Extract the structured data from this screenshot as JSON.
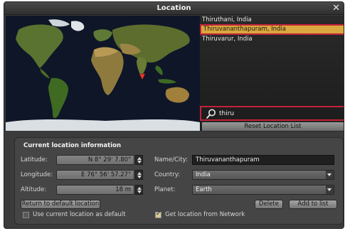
{
  "window": {
    "title": "Location",
    "close_glyph": "✕"
  },
  "location_list": {
    "items": [
      {
        "label": "Thiruthani, India",
        "selected": false
      },
      {
        "label": "Thiruvananthapuram, India",
        "selected": true
      },
      {
        "label": "Thiruvarur, India",
        "selected": false
      }
    ]
  },
  "search": {
    "value": "thiru",
    "icon": "search-icon"
  },
  "reset_button_label": "Reset Location List",
  "info": {
    "heading": "Current location information",
    "latitude_label": "Latitude:",
    "latitude_value": "N 8° 29' 7.80\"",
    "longitude_label": "Longitude:",
    "longitude_value": "E 76° 56' 57.27\"",
    "altitude_label": "Altitude:",
    "altitude_value": "18 m",
    "name_label": "Name/City:",
    "name_value": "Thiruvananthapuram",
    "country_label": "Country:",
    "country_value": "India",
    "planet_label": "Planet:",
    "planet_value": "Earth",
    "return_button": "Return to default location",
    "delete_button": "Delete",
    "add_button": "Add to list",
    "use_default_label": "Use current location as default",
    "use_default_checked": false,
    "network_label": "Get location from Network",
    "network_checked": true
  },
  "colors": {
    "accent_highlight": "#d9a83e",
    "selection_border": "#c3233a",
    "location_marker": "#e23b2e",
    "land": "#4f6b2a",
    "ocean": "#0d1424"
  }
}
